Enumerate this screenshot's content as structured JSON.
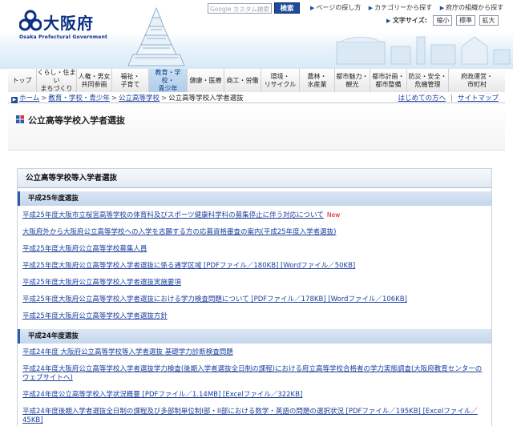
{
  "header": {
    "logo_text": "大阪府",
    "logo_sub": "Osaka Prefectural Government",
    "search_placeholder": "Google カスタム検索",
    "search_button": "検索",
    "util_links": [
      "ページの探し方",
      "カテゴリーから探す",
      "府庁の組織から探す"
    ],
    "text_size_label": "文字サイズ:",
    "text_size_options": [
      "縮小",
      "標準",
      "拡大"
    ]
  },
  "nav": {
    "items": [
      {
        "label": "トップ"
      },
      {
        "label": "くらし・住まい\nまちづくり"
      },
      {
        "label": "人権・男女\n共同参画"
      },
      {
        "label": "福祉・\n子育て"
      },
      {
        "label": "教育・学校・\n青少年",
        "active": true
      },
      {
        "label": "健康・医療"
      },
      {
        "label": "商工・労働"
      },
      {
        "label": "環境・\nリサイクル"
      },
      {
        "label": "農林・\n水産業"
      },
      {
        "label": "都市魅力・\n観光"
      },
      {
        "label": "都市計画・\n都市整備"
      },
      {
        "label": "防災・安全・\n危機管理"
      },
      {
        "label": "府政運営・\n市町村"
      }
    ]
  },
  "breadcrumb": {
    "items": [
      "ホーム",
      "教育・学校・青少年",
      "公立高等学校"
    ],
    "current": "公立高等学校入学者選抜",
    "right_links": [
      "はじめての方へ",
      "サイトマップ"
    ]
  },
  "page": {
    "title": "公立高等学校入学者選抜"
  },
  "content": {
    "box_title": "公立高等学校等入学者選抜",
    "sections": [
      {
        "heading": "平成25年度選抜",
        "links": [
          {
            "text": "平成25年度大阪市立桜宮高等学校の体育科及びスポーツ健康科学科の募集停止に伴う対応について",
            "badge": "New"
          },
          {
            "text": "大阪府外から大阪府公立高等学校への入学を志願する方の応募資格審査の案内(平成25年度入学者選抜)"
          },
          {
            "text": "平成25年度大阪府公立高等学校募集人員"
          },
          {
            "text": "平成25年度大阪府公立高等学校入学者選抜に係る通学区域 [PDFファイル／180KB] [Wordファイル／50KB]"
          },
          {
            "text": "平成25年度大阪府公立高等学校入学者選抜実施要項"
          },
          {
            "text": "平成25年度大阪府公立高等学校入学者選抜における学力検査問題について [PDFファイル／178KB] [Wordファイル／106KB]"
          },
          {
            "text": "平成25年度大阪府公立高等学校入学者選抜方針"
          }
        ]
      },
      {
        "heading": "平成24年度選抜",
        "links": [
          {
            "text": "平成24年度 大阪府公立高等学校等入学者選抜 基礎学力診断検査問題"
          },
          {
            "text": "平成24年度大阪府公立高等学校入学者選抜学力検査(後期入学者選抜全日制の課程)における府立高等学校合格者の学力実態調査(大阪府教育センターのウェブサイトへ)"
          },
          {
            "text": "平成24年度公立高等学校入学状況概要 [PDFファイル／1.14MB] [Excelファイル／322KB]"
          },
          {
            "text": "平成24年度後期入学者選抜全日制の課程及び多部制単位制I部・II部における数学・英語の問題の選択状況 [PDFファイル／195KB] [Excelファイル／45KB]"
          }
        ]
      }
    ]
  },
  "colors": {
    "link": "#1a3f9c",
    "new_badge": "#e01010",
    "brand": "#0b2f84"
  }
}
